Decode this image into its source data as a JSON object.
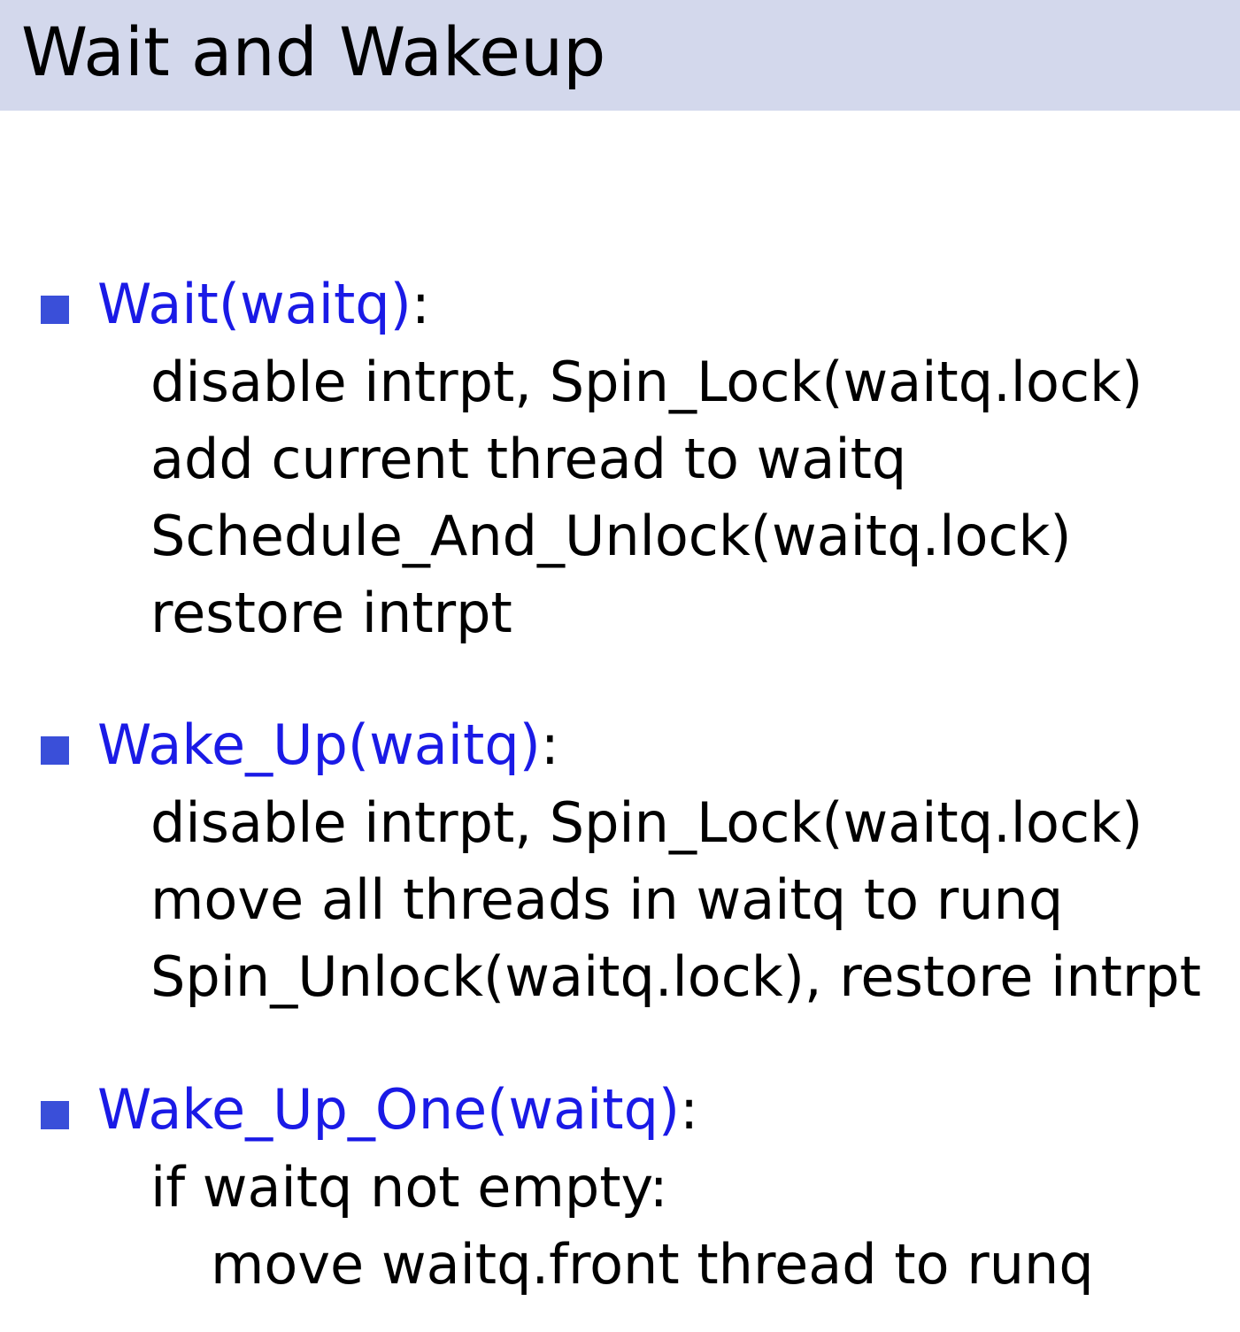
{
  "slide": {
    "title": "Wait and Wakeup"
  },
  "items": [
    {
      "name": "Wait(waitq)",
      "colon": ":",
      "lines": [
        "disable intrpt, Spin_Lock(waitq.lock)",
        "add current thread to waitq",
        "Schedule_And_Unlock(waitq.lock)",
        "restore intrpt"
      ]
    },
    {
      "name": "Wake_Up(waitq)",
      "colon": ":",
      "lines": [
        "disable intrpt, Spin_Lock(waitq.lock)",
        "move all threads in waitq to runq",
        "Spin_Unlock(waitq.lock), restore intrpt"
      ]
    },
    {
      "name": "Wake_Up_One(waitq)",
      "colon": ":",
      "lines": [
        "if waitq not empty:",
        "move waitq.front thread to runq"
      ]
    }
  ],
  "colors": {
    "title_bar": "#d3d8ec",
    "bullet": "#3a4fd9",
    "function_name": "#1a1ae6",
    "text": "#000000"
  }
}
